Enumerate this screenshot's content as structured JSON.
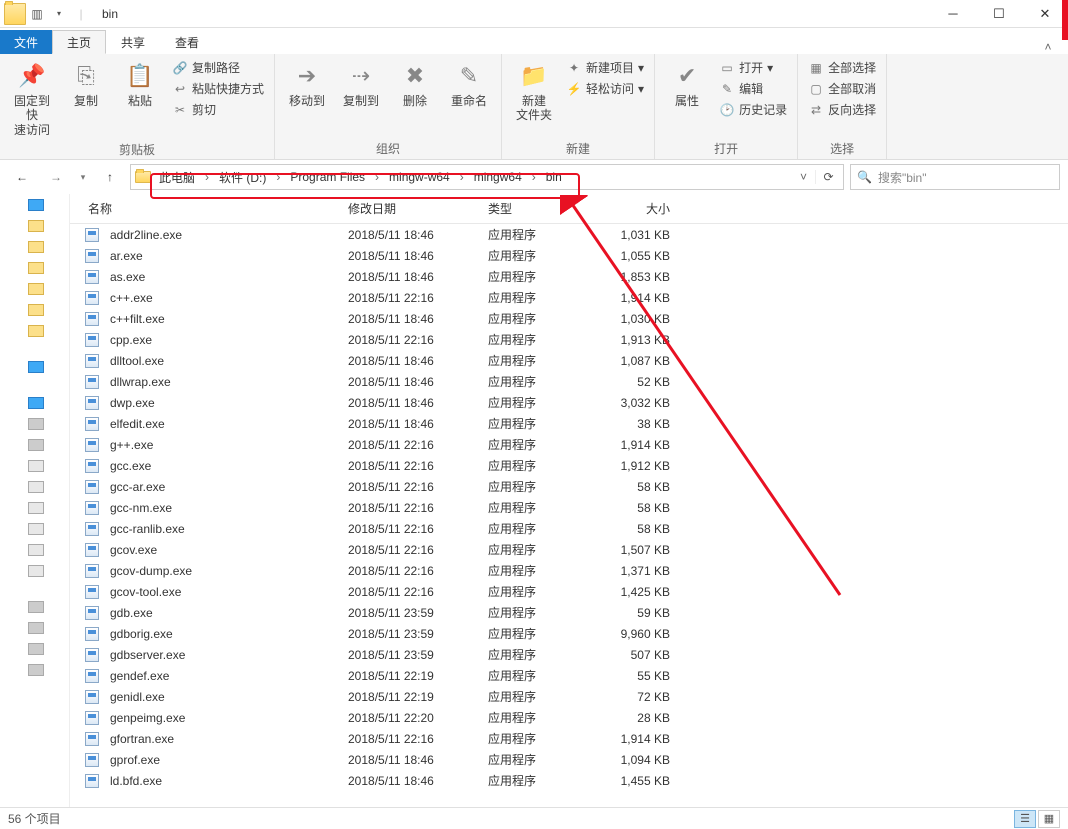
{
  "window": {
    "title": "bin"
  },
  "tabs": {
    "file": "文件",
    "home": "主页",
    "share": "共享",
    "view": "查看"
  },
  "ribbon": {
    "clipboard": {
      "pin": "固定到快\n速访问",
      "copy": "复制",
      "paste": "粘贴",
      "copypath": "复制路径",
      "pastesc": "粘贴快捷方式",
      "cut": "剪切",
      "label": "剪贴板"
    },
    "organize": {
      "moveto": "移动到",
      "copyto": "复制到",
      "delete": "删除",
      "rename": "重命名",
      "label": "组织"
    },
    "new": {
      "newfolder": "新建\n文件夹",
      "newitem": "新建项目",
      "easyaccess": "轻松访问",
      "label": "新建"
    },
    "open": {
      "props": "属性",
      "open": "打开",
      "edit": "编辑",
      "history": "历史记录",
      "label": "打开"
    },
    "select": {
      "all": "全部选择",
      "none": "全部取消",
      "invert": "反向选择",
      "label": "选择"
    }
  },
  "breadcrumb": [
    "此电脑",
    "软件 (D:)",
    "Program Files",
    "mingw-w64",
    "mingw64",
    "bin"
  ],
  "search": {
    "placeholder": "搜索\"bin\""
  },
  "columns": {
    "name": "名称",
    "date": "修改日期",
    "type": "类型",
    "size": "大小"
  },
  "filetype": "应用程序",
  "files": [
    {
      "name": "addr2line.exe",
      "date": "2018/5/11 18:46",
      "size": "1,031 KB"
    },
    {
      "name": "ar.exe",
      "date": "2018/5/11 18:46",
      "size": "1,055 KB"
    },
    {
      "name": "as.exe",
      "date": "2018/5/11 18:46",
      "size": "1,853 KB"
    },
    {
      "name": "c++.exe",
      "date": "2018/5/11 22:16",
      "size": "1,914 KB"
    },
    {
      "name": "c++filt.exe",
      "date": "2018/5/11 18:46",
      "size": "1,030 KB"
    },
    {
      "name": "cpp.exe",
      "date": "2018/5/11 22:16",
      "size": "1,913 KB"
    },
    {
      "name": "dlltool.exe",
      "date": "2018/5/11 18:46",
      "size": "1,087 KB"
    },
    {
      "name": "dllwrap.exe",
      "date": "2018/5/11 18:46",
      "size": "52 KB"
    },
    {
      "name": "dwp.exe",
      "date": "2018/5/11 18:46",
      "size": "3,032 KB"
    },
    {
      "name": "elfedit.exe",
      "date": "2018/5/11 18:46",
      "size": "38 KB"
    },
    {
      "name": "g++.exe",
      "date": "2018/5/11 22:16",
      "size": "1,914 KB"
    },
    {
      "name": "gcc.exe",
      "date": "2018/5/11 22:16",
      "size": "1,912 KB"
    },
    {
      "name": "gcc-ar.exe",
      "date": "2018/5/11 22:16",
      "size": "58 KB"
    },
    {
      "name": "gcc-nm.exe",
      "date": "2018/5/11 22:16",
      "size": "58 KB"
    },
    {
      "name": "gcc-ranlib.exe",
      "date": "2018/5/11 22:16",
      "size": "58 KB"
    },
    {
      "name": "gcov.exe",
      "date": "2018/5/11 22:16",
      "size": "1,507 KB"
    },
    {
      "name": "gcov-dump.exe",
      "date": "2018/5/11 22:16",
      "size": "1,371 KB"
    },
    {
      "name": "gcov-tool.exe",
      "date": "2018/5/11 22:16",
      "size": "1,425 KB"
    },
    {
      "name": "gdb.exe",
      "date": "2018/5/11 23:59",
      "size": "59 KB"
    },
    {
      "name": "gdborig.exe",
      "date": "2018/5/11 23:59",
      "size": "9,960 KB"
    },
    {
      "name": "gdbserver.exe",
      "date": "2018/5/11 23:59",
      "size": "507 KB"
    },
    {
      "name": "gendef.exe",
      "date": "2018/5/11 22:19",
      "size": "55 KB"
    },
    {
      "name": "genidl.exe",
      "date": "2018/5/11 22:19",
      "size": "72 KB"
    },
    {
      "name": "genpeimg.exe",
      "date": "2018/5/11 22:20",
      "size": "28 KB"
    },
    {
      "name": "gfortran.exe",
      "date": "2018/5/11 22:16",
      "size": "1,914 KB"
    },
    {
      "name": "gprof.exe",
      "date": "2018/5/11 18:46",
      "size": "1,094 KB"
    },
    {
      "name": "ld.bfd.exe",
      "date": "2018/5/11 18:46",
      "size": "1,455 KB"
    }
  ],
  "status": {
    "count": "56 个项目"
  }
}
